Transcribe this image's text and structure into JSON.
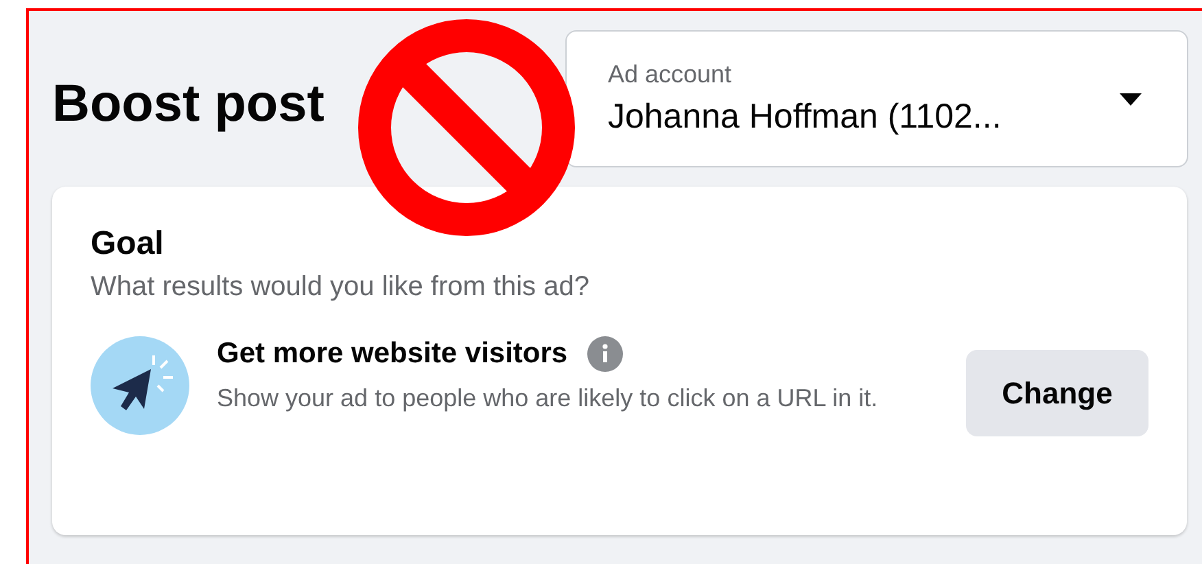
{
  "header": {
    "title": "Boost post"
  },
  "ad_account": {
    "label": "Ad account",
    "value": "Johanna Hoffman (1102..."
  },
  "goal": {
    "title": "Goal",
    "subtitle": "What results would you like from this ad?",
    "option": {
      "title": "Get more website visitors",
      "description": "Show your ad to people who are likely to click on a URL in it."
    },
    "button": "Change"
  },
  "overlay": {
    "kind": "prohibition"
  }
}
